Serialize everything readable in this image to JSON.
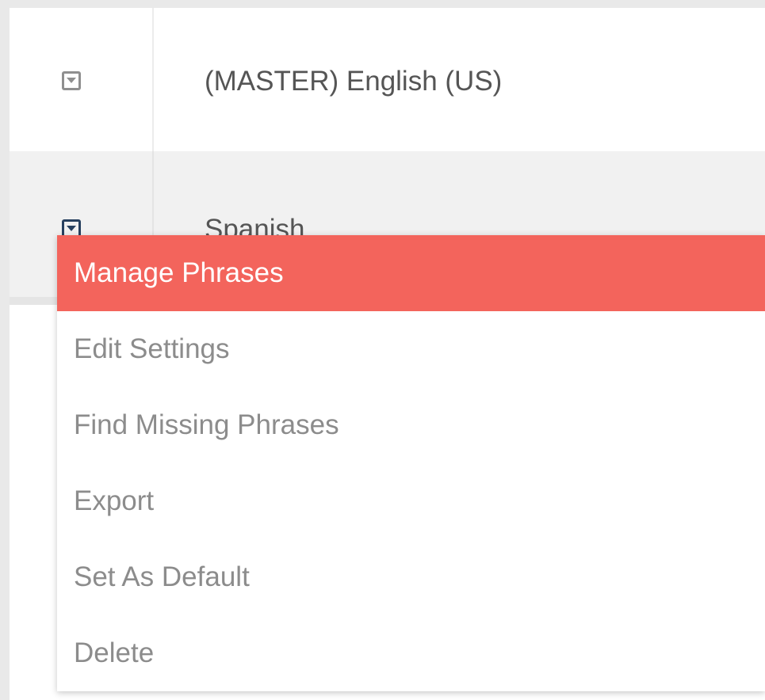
{
  "languages": {
    "rows": [
      {
        "label": "(MASTER) English (US)",
        "icon": "caret-down-square-icon",
        "icon_color": "#8f8f8f"
      },
      {
        "label": "Spanish",
        "icon": "caret-down-square-icon",
        "icon_color": "#27405f"
      }
    ]
  },
  "context_menu": {
    "highlight_color": "#f3645c",
    "items": [
      {
        "label": "Manage Phrases",
        "active": true
      },
      {
        "label": "Edit Settings",
        "active": false
      },
      {
        "label": "Find Missing Phrases",
        "active": false
      },
      {
        "label": "Export",
        "active": false
      },
      {
        "label": "Set As Default",
        "active": false
      },
      {
        "label": "Delete",
        "active": false
      }
    ]
  }
}
